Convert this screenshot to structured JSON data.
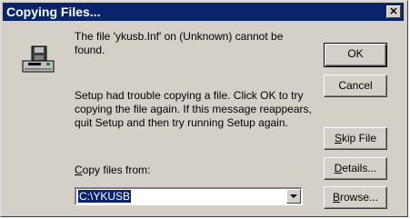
{
  "window": {
    "title": "Copying Files...",
    "close_glyph": "✕"
  },
  "message": {
    "line1": "The file 'ykusb.Inf' on (Unknown) cannot be found.",
    "line2": "Setup had trouble copying a file. Click OK to try copying the file again. If this message reappears, quit Setup and then try running Setup again."
  },
  "buttons": {
    "ok": "OK",
    "cancel": "Cancel",
    "skip_prefix": "",
    "skip_mnemonic": "S",
    "skip_rest": "kip File",
    "details_prefix": "",
    "details_mnemonic": "D",
    "details_rest": "etails...",
    "browse_prefix": "",
    "browse_mnemonic": "B",
    "browse_rest": "rowse..."
  },
  "copy_from": {
    "label_mnemonic": "C",
    "label_rest": "opy files from:",
    "value": "C:\\YKUSB"
  },
  "icons": {
    "dialog_icon": "disk-drive-icon",
    "dropdown_icon": "chevron-down-icon"
  }
}
